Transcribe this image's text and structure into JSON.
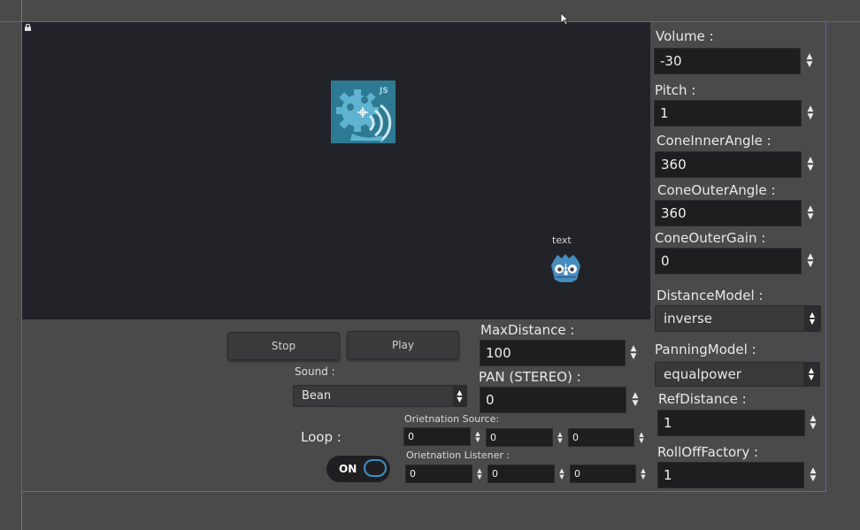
{
  "viewport": {
    "node_label": "text"
  },
  "controls": {
    "stop_label": "Stop",
    "play_label": "Play",
    "sound_label": "Sound  :",
    "sound_value": "Bean",
    "loop_label": "Loop  :",
    "loop_toggle": "ON",
    "max_distance_label": "MaxDistance :",
    "max_distance_value": "100",
    "pan_label": "PAN (STEREO) :",
    "pan_value": "0",
    "orientation_source_label": "Orietnation Source:",
    "orientation_source": [
      "0",
      "0",
      "0"
    ],
    "orientation_listener_label": "Orietnation Listener :",
    "orientation_listener": [
      "0",
      "0",
      "0"
    ]
  },
  "panel": {
    "volume_label": "Volume :",
    "volume_value": "-30",
    "pitch_label": "Pitch :",
    "pitch_value": "1",
    "cone_inner_label": "ConeInnerAngle :",
    "cone_inner_value": "360",
    "cone_outer_label": "ConeOuterAngle :",
    "cone_outer_value": "360",
    "cone_outer_gain_label": "ConeOuterGain :",
    "cone_outer_gain_value": "0",
    "distance_model_label": "DistanceModel :",
    "distance_model_value": "inverse",
    "panning_model_label": "PanningModel :",
    "panning_model_value": "equalpower",
    "ref_distance_label": "RefDistance :",
    "ref_distance_value": "1",
    "rolloff_label": "RollOffFactory :",
    "rolloff_value": "1"
  },
  "icons": {
    "speaker_icon": "audio-stream-player-icon",
    "godot_icon": "godot-robot-icon",
    "lock_icon": "lock-icon",
    "cursor": "mouse-pointer-icon"
  },
  "colors": {
    "background": "#4a4a4a",
    "viewport": "#222328",
    "field": "#1e1e20",
    "accent": "#3d8fc4",
    "icon_teal": "#2e7a93"
  }
}
